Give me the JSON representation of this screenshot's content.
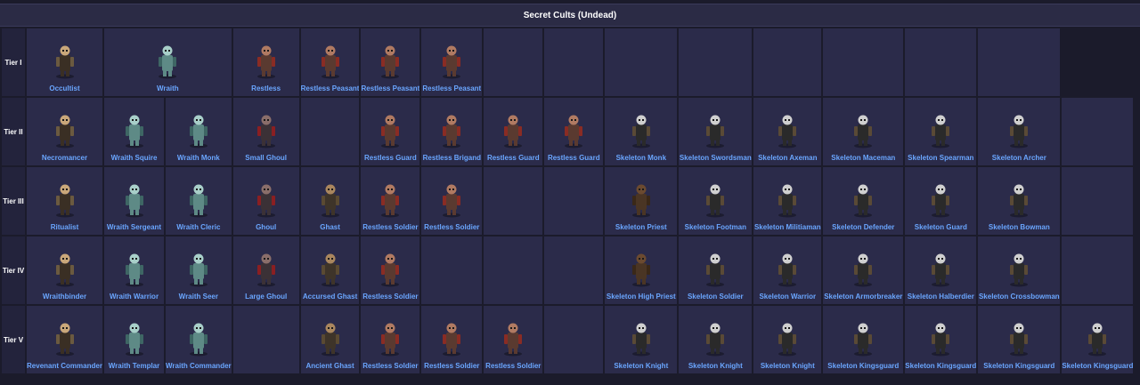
{
  "title": "Secret Cults (Undead)",
  "colors": {
    "link": "#6aa6ff",
    "cell": "#2b2b4a",
    "background": "#1b1b2b"
  },
  "rows": [
    {
      "tier": "Tier I",
      "cells": [
        {
          "name": "Occultist",
          "type": "robed"
        },
        {
          "name": "Wraith",
          "type": "wraith",
          "span": 2
        },
        null,
        {
          "name": "Restless",
          "type": "restless"
        },
        {
          "name": "Restless Peasant",
          "type": "restless"
        },
        {
          "name": "Restless Peasant",
          "type": "restless"
        },
        {
          "name": "Restless Peasant",
          "type": "restless"
        },
        null,
        null,
        null,
        null,
        null,
        null,
        null,
        null
      ]
    },
    {
      "tier": "Tier II",
      "cells": [
        {
          "name": "Necromancer",
          "type": "robed"
        },
        {
          "name": "Wraith Squire",
          "type": "wraith"
        },
        {
          "name": "Wraith Monk",
          "type": "wraith"
        },
        {
          "name": "Small Ghoul",
          "type": "ghoul"
        },
        null,
        {
          "name": "Restless Guard",
          "type": "restless"
        },
        {
          "name": "Restless Brigand",
          "type": "restless"
        },
        {
          "name": "Restless Guard",
          "type": "restless"
        },
        {
          "name": "Restless Guard",
          "type": "restless"
        },
        {
          "name": "Skeleton Monk",
          "type": "skeleton"
        },
        {
          "name": "Skeleton Swordsman",
          "type": "skeleton"
        },
        {
          "name": "Skeleton Axeman",
          "type": "skeleton"
        },
        {
          "name": "Skeleton Maceman",
          "type": "skeleton"
        },
        {
          "name": "Skeleton Spearman",
          "type": "skeleton"
        },
        {
          "name": "Skeleton Archer",
          "type": "skeleton"
        },
        null
      ]
    },
    {
      "tier": "Tier III",
      "cells": [
        {
          "name": "Ritualist",
          "type": "robed"
        },
        {
          "name": "Wraith Sergeant",
          "type": "wraith"
        },
        {
          "name": "Wraith Cleric",
          "type": "wraith"
        },
        {
          "name": "Ghoul",
          "type": "ghoul"
        },
        {
          "name": "Ghast",
          "type": "ghast"
        },
        {
          "name": "Restless Soldier",
          "type": "restless"
        },
        {
          "name": "Restless Soldier",
          "type": "restless"
        },
        null,
        null,
        {
          "name": "Skeleton Priest",
          "type": "priest"
        },
        {
          "name": "Skeleton Footman",
          "type": "skeleton"
        },
        {
          "name": "Skeleton Militiaman",
          "type": "skeleton"
        },
        {
          "name": "Skeleton Defender",
          "type": "skeleton"
        },
        {
          "name": "Skeleton Guard",
          "type": "skeleton"
        },
        {
          "name": "Skeleton Bowman",
          "type": "skeleton"
        },
        null
      ]
    },
    {
      "tier": "Tier IV",
      "cells": [
        {
          "name": "Wraithbinder",
          "type": "robed"
        },
        {
          "name": "Wraith Warrior",
          "type": "wraith"
        },
        {
          "name": "Wraith Seer",
          "type": "wraith"
        },
        {
          "name": "Large Ghoul",
          "type": "ghoul"
        },
        {
          "name": "Accursed Ghast",
          "type": "ghast"
        },
        {
          "name": "Restless Soldier",
          "type": "restless"
        },
        null,
        null,
        null,
        {
          "name": "Skeleton High Priest",
          "type": "priest"
        },
        {
          "name": "Skeleton Soldier",
          "type": "skeleton"
        },
        {
          "name": "Skeleton Warrior",
          "type": "skeleton"
        },
        {
          "name": "Skeleton Armorbreaker",
          "type": "skeleton"
        },
        {
          "name": "Skeleton Halberdier",
          "type": "skeleton"
        },
        {
          "name": "Skeleton Crossbowman",
          "type": "skeleton"
        },
        null
      ]
    },
    {
      "tier": "Tier V",
      "cells": [
        {
          "name": "Revenant Commander",
          "type": "robed"
        },
        {
          "name": "Wraith Templar",
          "type": "wraith"
        },
        {
          "name": "Wraith Commander",
          "type": "wraith"
        },
        null,
        {
          "name": "Ancient Ghast",
          "type": "ghast"
        },
        {
          "name": "Restless Soldier",
          "type": "restless"
        },
        {
          "name": "Restless Soldier",
          "type": "restless"
        },
        {
          "name": "Restless Soldier",
          "type": "restless"
        },
        null,
        {
          "name": "Skeleton Knight",
          "type": "skeleton"
        },
        {
          "name": "Skeleton Knight",
          "type": "skeleton"
        },
        {
          "name": "Skeleton Knight",
          "type": "skeleton"
        },
        {
          "name": "Skeleton Kingsguard",
          "type": "skeleton"
        },
        {
          "name": "Skeleton Kingsguard",
          "type": "skeleton"
        },
        {
          "name": "Skeleton Kingsguard",
          "type": "skeleton"
        },
        {
          "name": "Skeleton Kingsguard",
          "type": "skeleton"
        }
      ]
    }
  ]
}
